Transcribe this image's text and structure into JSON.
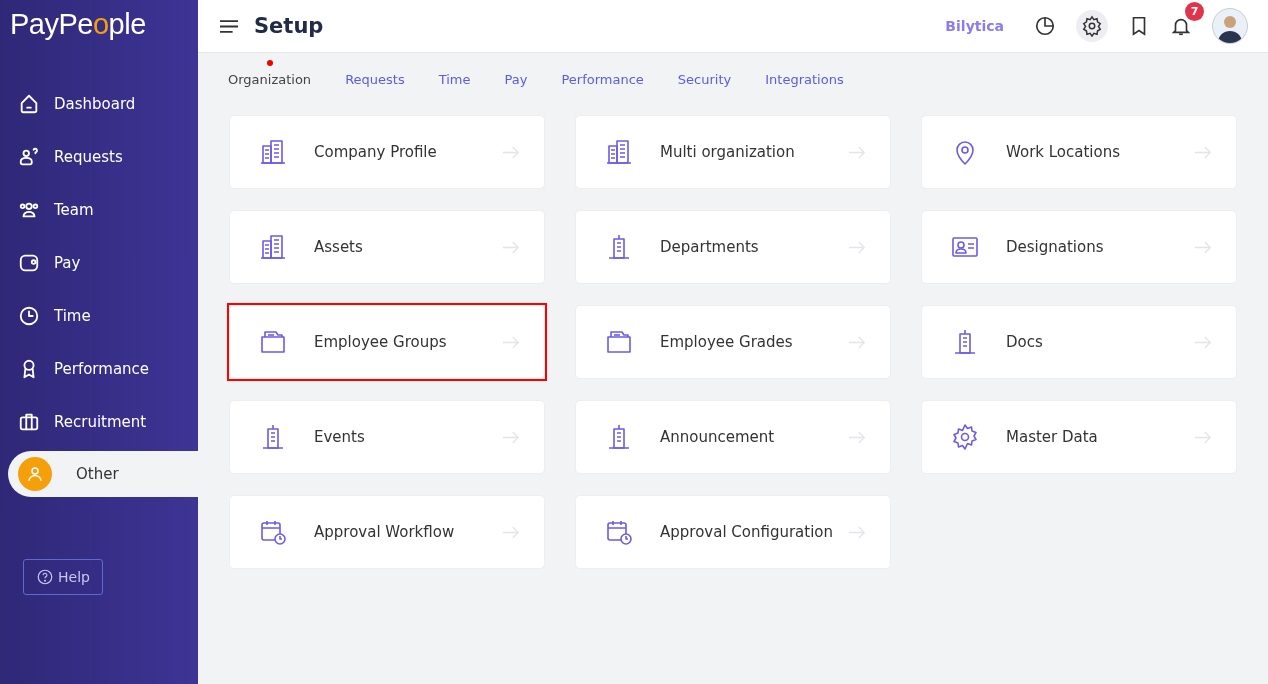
{
  "logo": {
    "before": "PayPe",
    "accent": "o",
    "after": "ple"
  },
  "sidebar": {
    "items": [
      {
        "label": "Dashboard",
        "kind": "home",
        "selected": false
      },
      {
        "label": "Requests",
        "kind": "requests",
        "selected": false
      },
      {
        "label": "Team",
        "kind": "team",
        "selected": false
      },
      {
        "label": "Pay",
        "kind": "wallet",
        "selected": false
      },
      {
        "label": "Time",
        "kind": "clock",
        "selected": false
      },
      {
        "label": "Performance",
        "kind": "award",
        "selected": false
      },
      {
        "label": "Recruitment",
        "kind": "briefcase",
        "selected": false
      },
      {
        "label": "Other",
        "kind": "user",
        "selected": true
      }
    ],
    "help": "Help"
  },
  "header": {
    "title": "Setup",
    "company": "Bilytica",
    "notifications": "7"
  },
  "tabs": [
    {
      "label": "Organization",
      "selected": true
    },
    {
      "label": "Requests",
      "selected": false
    },
    {
      "label": "Time",
      "selected": false
    },
    {
      "label": "Pay",
      "selected": false
    },
    {
      "label": "Performance",
      "selected": false
    },
    {
      "label": "Security",
      "selected": false
    },
    {
      "label": "Integrations",
      "selected": false
    }
  ],
  "cards": [
    {
      "label": "Company Profile",
      "kind": "buildings",
      "highlighted": false
    },
    {
      "label": "Multi organization",
      "kind": "buildings",
      "highlighted": false
    },
    {
      "label": "Work Locations",
      "kind": "pin",
      "highlighted": false
    },
    {
      "label": "Assets",
      "kind": "buildings",
      "highlighted": false
    },
    {
      "label": "Departments",
      "kind": "tower",
      "highlighted": false
    },
    {
      "label": "Designations",
      "kind": "idcard",
      "highlighted": false
    },
    {
      "label": "Employee Groups",
      "kind": "folder",
      "highlighted": true
    },
    {
      "label": "Employee Grades",
      "kind": "folder",
      "highlighted": false
    },
    {
      "label": "Docs",
      "kind": "tower",
      "highlighted": false
    },
    {
      "label": "Events",
      "kind": "tower",
      "highlighted": false
    },
    {
      "label": "Announcement",
      "kind": "tower",
      "highlighted": false
    },
    {
      "label": "Master Data",
      "kind": "gear",
      "highlighted": false
    },
    {
      "label": "Approval Workflow",
      "kind": "calendar",
      "highlighted": false
    },
    {
      "label": "Approval Configuration",
      "kind": "calendar",
      "highlighted": false
    }
  ]
}
